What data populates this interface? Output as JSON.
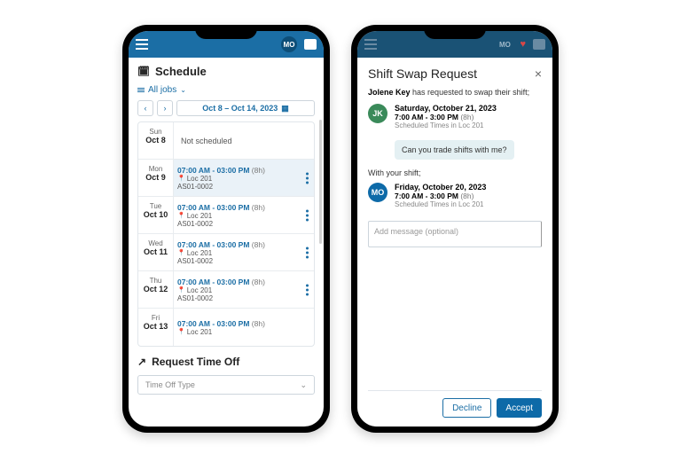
{
  "left": {
    "avatar": "MO",
    "title": "Schedule",
    "filter_label": "All jobs",
    "week_range": "Oct 8 – Oct 14, 2023",
    "not_scheduled": "Not scheduled",
    "days": [
      {
        "dow": "Sun",
        "date": "Oct 8"
      },
      {
        "dow": "Mon",
        "date": "Oct 9"
      },
      {
        "dow": "Tue",
        "date": "Oct 10"
      },
      {
        "dow": "Wed",
        "date": "Oct 11"
      },
      {
        "dow": "Thu",
        "date": "Oct 12"
      },
      {
        "dow": "Fri",
        "date": "Oct 13"
      }
    ],
    "shift": {
      "time": "07:00 AM - 03:00 PM",
      "dur": "(8h)",
      "loc": "Loc 201",
      "code": "AS01-0002"
    },
    "rto_title": "Request Time Off",
    "rto_placeholder": "Time Off Type"
  },
  "right": {
    "avatar": "MO",
    "title": "Shift Swap Request",
    "requester": "Jolene Key",
    "request_tail": "has requested to swap their shift;",
    "jk_initials": "JK",
    "their_shift": {
      "date": "Saturday, October 21, 2023",
      "time": "7:00 AM - 3:00 PM",
      "dur": "(8h)",
      "sched": "Scheduled Times in Loc 201"
    },
    "message": "Can you trade shifts with me?",
    "with_label": "With your shift;",
    "mo_initials": "MO",
    "your_shift": {
      "date": "Friday, October 20, 2023",
      "time": "7:00 AM - 3:00 PM",
      "dur": "(8h)",
      "sched": "Scheduled Times in Loc 201"
    },
    "msg_placeholder": "Add message (optional)",
    "decline": "Decline",
    "accept": "Accept"
  }
}
